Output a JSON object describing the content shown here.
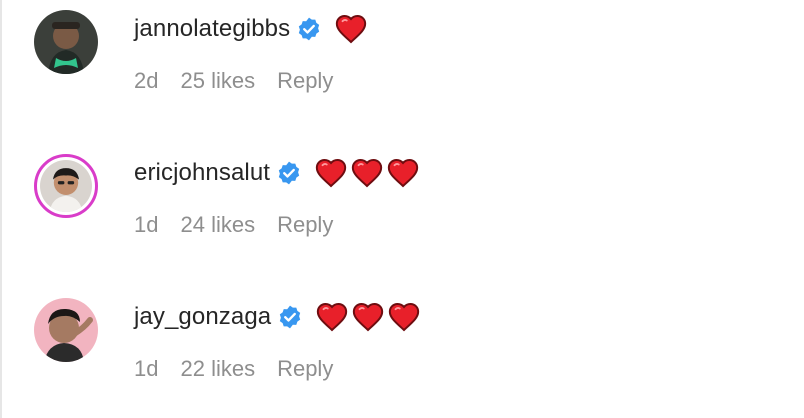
{
  "comments": [
    {
      "username": "jannolategibbs",
      "verified_icon": "verified-badge-icon",
      "reaction_emoji": [
        "heart-icon"
      ],
      "time": "2d",
      "likes": "25 likes",
      "reply_label": "Reply",
      "avatar_ring": false
    },
    {
      "username": "ericjohnsalut",
      "verified_icon": "verified-badge-icon",
      "reaction_emoji": [
        "heart-icon",
        "heart-icon",
        "heart-icon"
      ],
      "time": "1d",
      "likes": "24 likes",
      "reply_label": "Reply",
      "avatar_ring": true
    },
    {
      "username": "jay_gonzaga",
      "verified_icon": "verified-badge-icon",
      "reaction_emoji": [
        "heart-icon",
        "heart-icon",
        "heart-icon"
      ],
      "time": "1d",
      "likes": "22 likes",
      "reply_label": "Reply",
      "avatar_ring": false
    }
  ],
  "colors": {
    "username": "#262626",
    "meta": "#8e8e8e",
    "verified_badge": "#3897f0",
    "heart": "#e8202a",
    "story_ring": "#d93cc9"
  }
}
